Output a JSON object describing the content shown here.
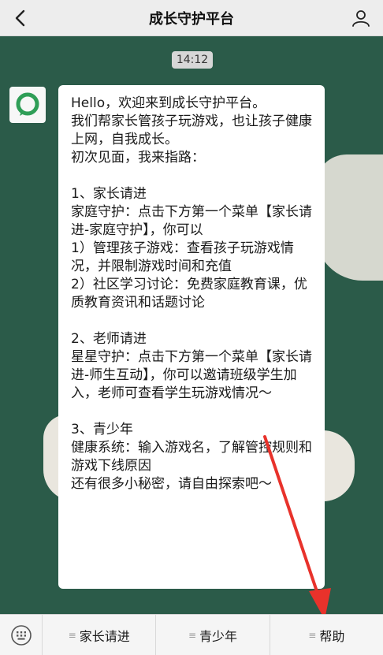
{
  "header": {
    "title": "成长守护平台",
    "back_icon": "chevron-left-icon",
    "profile_icon": "person-icon"
  },
  "chat": {
    "timestamp": "14:12",
    "avatar_icon": "chat-bubble-icon",
    "message_lines": [
      "Hello，欢迎来到成长守护平台。",
      "我们帮家长管孩子玩游戏，也让孩子健康上网，自我成长。",
      "初次见面，我来指路：",
      "",
      "1、家长请进",
      "家庭守护：点击下方第一个菜单【家长请进-家庭守护】，你可以",
      "1）管理孩子游戏：查看孩子玩游戏情况，并限制游戏时间和充值",
      "2）社区学习讨论：免费家庭教育课，优质教育资讯和话题讨论",
      "",
      "2、老师请进",
      "星星守护：点击下方第一个菜单【家长请进-师生互动】，你可以邀请班级学生加入，老师可查看学生玩游戏情况～",
      "",
      "3、青少年",
      "健康系统：输入游戏名，了解管控规则和游戏下线原因",
      "还有很多小秘密，请自由探索吧～"
    ]
  },
  "bottom_menu": {
    "keyboard_icon": "keyboard-icon",
    "items": [
      {
        "label": "家长请进",
        "icon": "menu-lines-icon"
      },
      {
        "label": "青少年",
        "icon": "menu-lines-icon"
      },
      {
        "label": "帮助",
        "icon": "menu-lines-icon"
      }
    ]
  },
  "colors": {
    "accent": "#2f9e57",
    "chat_bg": "#2b5b49",
    "arrow": "#e8322b"
  }
}
